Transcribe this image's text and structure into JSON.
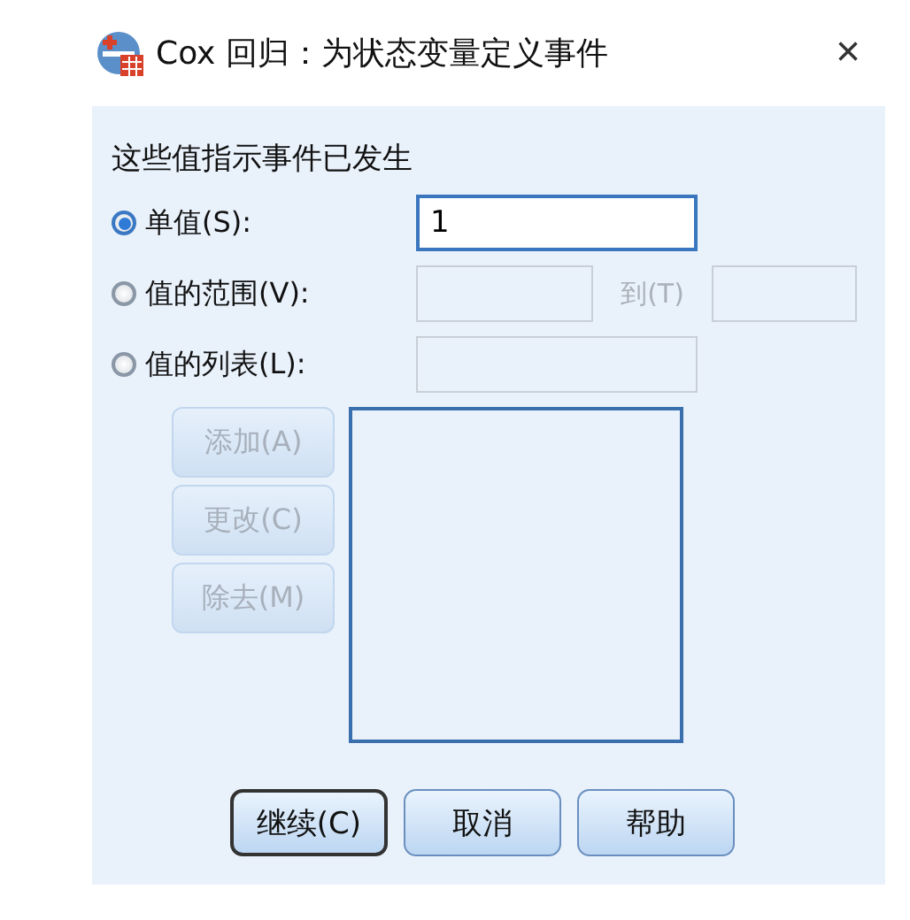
{
  "window": {
    "title": "Cox 回归：为状态变量定义事件",
    "close": "×"
  },
  "heading": "这些值指示事件已发生",
  "options": [
    {
      "kind": "single",
      "label": "单值(S):",
      "selected": true,
      "value": "1",
      "disabled": false
    },
    {
      "kind": "range",
      "label": "值的范围(V):",
      "selected": false,
      "joiner": "到(T)",
      "disabled": true
    },
    {
      "kind": "list",
      "label": "值的列表(L):",
      "selected": false,
      "disabled": true
    }
  ],
  "list_buttons": [
    {
      "label": "添加(A)",
      "disabled": true
    },
    {
      "label": "更改(C)",
      "disabled": true
    },
    {
      "label": "除去(M)",
      "disabled": true
    }
  ],
  "buttons": [
    {
      "label": "继续(C)",
      "default": true
    },
    {
      "label": "取消",
      "default": false
    },
    {
      "label": "帮助",
      "default": false
    }
  ]
}
